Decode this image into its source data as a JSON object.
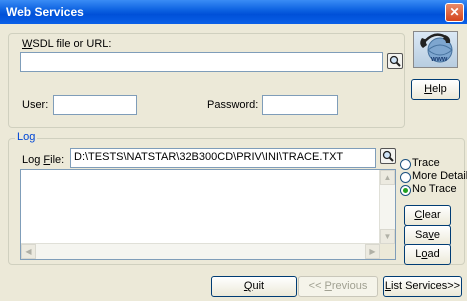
{
  "window": {
    "title": "Web Services",
    "close_symbol": "✕"
  },
  "wsdl": {
    "label_mnemonic": "W",
    "label_rest": "SDL file or URL:",
    "value": "",
    "browse_icon": "search-icon"
  },
  "user": {
    "label": "User:",
    "value": ""
  },
  "password": {
    "label": "Password:",
    "value": ""
  },
  "logo": {
    "icon": "web-phone-logo-icon",
    "text": "www"
  },
  "help": {
    "mnemonic": "H",
    "rest": "elp"
  },
  "log": {
    "group_title": "Log",
    "file_label_before": "Log ",
    "file_label_mnemonic": "F",
    "file_label_after": "ile:",
    "file_value": "D:\\TESTS\\NATSTAR\\32B300CD\\PRIV\\INI\\TRACE.TXT",
    "content": ""
  },
  "trace_options": [
    {
      "label": "Trace",
      "selected": false
    },
    {
      "label": "More Details",
      "selected": false
    },
    {
      "label": "No Trace",
      "selected": true
    }
  ],
  "log_buttons": {
    "clear": {
      "mnemonic": "C",
      "rest": "lear"
    },
    "save": {
      "before": "Sa",
      "mnemonic": "v",
      "after": "e"
    },
    "load": {
      "before": "L",
      "mnemonic": "o",
      "after": "ad"
    }
  },
  "footer": {
    "quit": {
      "mnemonic": "Q",
      "rest": "uit"
    },
    "previous": {
      "before": "<< ",
      "mnemonic": "P",
      "after": "revious"
    },
    "list_services": {
      "mnemonic": "L",
      "rest": "ist Services>>"
    }
  }
}
